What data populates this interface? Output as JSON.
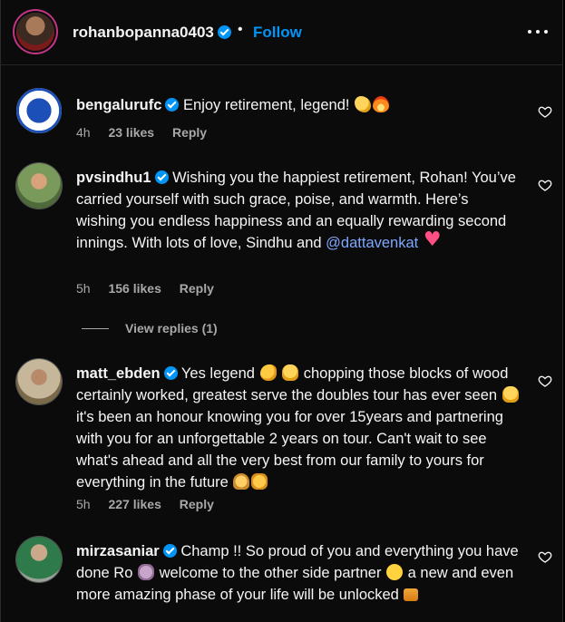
{
  "header": {
    "username": "rohanbopanna0403",
    "separator": "•",
    "follow_label": "Follow",
    "more_icon": "more-horizontal-icon"
  },
  "comments": [
    {
      "username": "bengalurufc",
      "text": "Enjoy retirement, legend!",
      "emojis": [
        "clapping-hands",
        "fire"
      ],
      "time": "4h",
      "likes": "23 likes",
      "reply": "Reply"
    },
    {
      "username": "pvsindhu1",
      "text": "Wishing you the happiest retirement, Rohan! You’ve carried yourself with such grace, poise, and warmth. Here’s wishing you endless happiness and an equally rewarding second innings. With lots of love, Sindhu and",
      "mention": "@dattavenkat",
      "emojis": [
        "pink-heart"
      ],
      "time": "5h",
      "likes": "156 likes",
      "reply": "Reply"
    },
    {
      "username": "matt_ebden",
      "text_1": "Yes legend",
      "text_2": "chopping those blocks of wood certainly worked, greatest serve the doubles tour has ever seen",
      "text_3": "it's been an honour knowing you for over 15years and partnering with you for an unforgettable 2 years on tour. Can't wait to see what's ahead and all the very best from our family to yours for everything in the future",
      "emojis": [
        "flexed-biceps",
        "raising-hands",
        "raising-hands",
        "folded-hands",
        "oncoming-fist"
      ],
      "time": "5h",
      "likes": "227 likes",
      "reply": "Reply"
    },
    {
      "username": "mirzasaniar",
      "text_1": "Champ !! So proud of you and everything you have done Ro",
      "text_2": "welcome to the other side partner",
      "text_3": "a new and even more amazing phase of your life will be unlocked",
      "emojis": [
        "waving-hand",
        "smiling-face",
        "unlocked"
      ]
    }
  ],
  "view_replies": "View replies (1)",
  "colors": {
    "background": "#0b0b0b",
    "text": "#f5f5f5",
    "muted": "#a8a8a8",
    "accent": "#0095f6",
    "mention": "#7fa7ff"
  }
}
